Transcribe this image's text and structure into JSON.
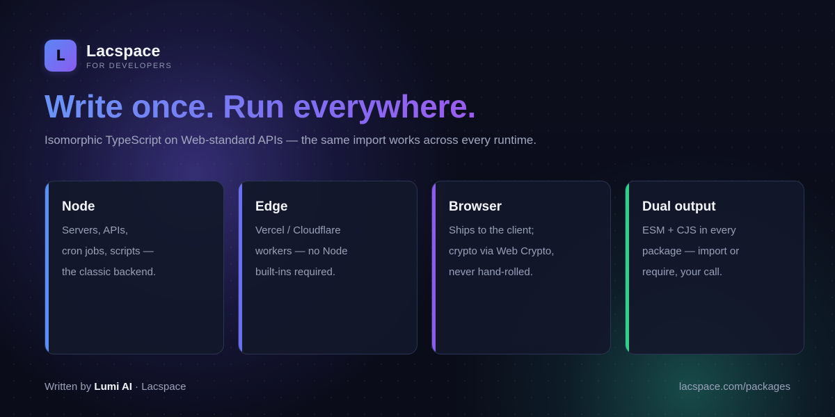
{
  "brand": {
    "logo_letter": "L",
    "name": "Lacspace",
    "tagline": "FOR DEVELOPERS"
  },
  "headline": "Write once. Run everywhere.",
  "subtitle": "Isomorphic TypeScript on Web-standard APIs — the same import works across every runtime.",
  "cards": [
    {
      "title": "Node",
      "accent_color": "#5b8ff6",
      "lines": [
        "Servers, APIs,",
        "cron jobs, scripts —",
        "the classic backend."
      ]
    },
    {
      "title": "Edge",
      "accent_color": "#6c6ff3",
      "lines": [
        "Vercel / Cloudflare",
        "workers — no Node",
        "built-ins required."
      ]
    },
    {
      "title": "Browser",
      "accent_color": "#8a5cf0",
      "lines": [
        "Ships to the client;",
        "crypto via Web Crypto,",
        "never hand-rolled."
      ]
    },
    {
      "title": "Dual output",
      "accent_color": "#2fd08a",
      "lines": [
        "ESM + CJS in every",
        "package — import or",
        "require, your call."
      ]
    }
  ],
  "footer": {
    "written_by_prefix": "Written by",
    "author": "Lumi AI",
    "separator": "·",
    "org": "Lacspace",
    "url": "lacspace.com/packages"
  },
  "colors": {
    "background": "#0b0d1b",
    "headline_gradient_start": "#6b93f7",
    "headline_gradient_end": "#9a5cf0",
    "logo_gradient_start": "#5b86f5",
    "logo_gradient_end": "#8a5cf0"
  }
}
